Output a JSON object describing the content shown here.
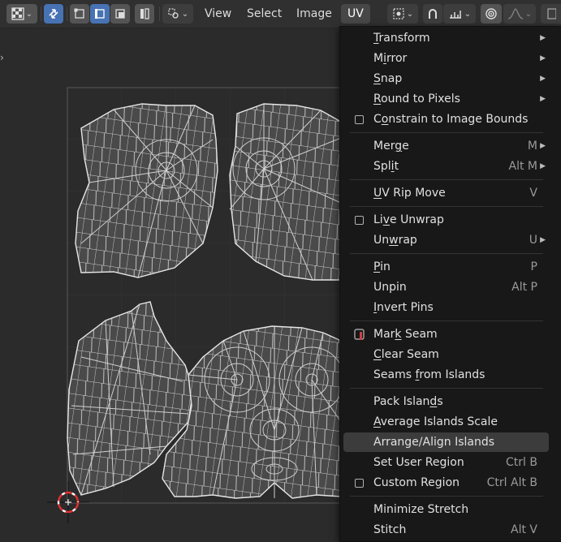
{
  "header": {
    "menus": [
      {
        "label": "View",
        "active": false
      },
      {
        "label": "Select",
        "active": false
      },
      {
        "label": "Image",
        "active": false
      },
      {
        "label": "UV",
        "active": true
      }
    ],
    "icons": [
      "editor-type-icon",
      "sync-selection-icon",
      "vertex-select-icon",
      "edge-select-icon",
      "face-select-icon",
      "island-select-icon",
      "sticky-selection-icon",
      "pivot-icon",
      "snap-magnet-icon",
      "snap-target-icon",
      "proportional-edit-icon",
      "falloff-icon"
    ]
  },
  "menu": {
    "items": [
      {
        "label": "Transform",
        "ul": "T",
        "shortcut": "",
        "submenu": true,
        "checkbox": false
      },
      {
        "label": "Mirror",
        "ul": "i",
        "shortcut": "",
        "submenu": true,
        "checkbox": false
      },
      {
        "label": "Snap",
        "ul": "S",
        "shortcut": "",
        "submenu": true,
        "checkbox": false
      },
      {
        "label": "Round to Pixels",
        "ul": "R",
        "shortcut": "",
        "submenu": true,
        "checkbox": false
      },
      {
        "label": "Constrain to Image Bounds",
        "ul": "o",
        "shortcut": "",
        "submenu": false,
        "checkbox": true
      },
      {
        "label": "Merge",
        "ul": "g",
        "shortcut": "M",
        "submenu": true,
        "checkbox": false
      },
      {
        "label": "Split",
        "ul": "i",
        "shortcut": "Alt M",
        "submenu": true,
        "checkbox": false
      },
      {
        "label": "UV Rip Move",
        "ul": "U",
        "shortcut": "V",
        "submenu": false,
        "checkbox": false
      },
      {
        "label": "Live Unwrap",
        "ul": "v",
        "shortcut": "",
        "submenu": false,
        "checkbox": true
      },
      {
        "label": "Unwrap",
        "ul": "w",
        "shortcut": "U",
        "submenu": true,
        "checkbox": false
      },
      {
        "label": "Pin",
        "ul": "P",
        "shortcut": "P",
        "submenu": false,
        "checkbox": false
      },
      {
        "label": "Unpin",
        "ul": "",
        "shortcut": "Alt P",
        "submenu": false,
        "checkbox": false
      },
      {
        "label": "Invert Pins",
        "ul": "I",
        "shortcut": "",
        "submenu": false,
        "checkbox": false
      },
      {
        "label": "Mark Seam",
        "ul": "k",
        "shortcut": "",
        "submenu": false,
        "checkbox": false,
        "icon": "mark-seam-icon"
      },
      {
        "label": "Clear Seam",
        "ul": "C",
        "shortcut": "",
        "submenu": false,
        "checkbox": false
      },
      {
        "label": "Seams from Islands",
        "ul": "f",
        "shortcut": "",
        "submenu": false,
        "checkbox": false
      },
      {
        "label": "Pack Islands",
        "ul": "d",
        "shortcut": "",
        "submenu": false,
        "checkbox": false
      },
      {
        "label": "Average Islands Scale",
        "ul": "A",
        "shortcut": "",
        "submenu": false,
        "checkbox": false
      },
      {
        "label": "Arrange/Align Islands",
        "ul": "",
        "shortcut": "",
        "submenu": false,
        "checkbox": false,
        "highlighted": true
      },
      {
        "label": "Set User Region",
        "ul": "",
        "shortcut": "Ctrl B",
        "submenu": false,
        "checkbox": false
      },
      {
        "label": "Custom Region",
        "ul": "",
        "shortcut": "Ctrl Alt B",
        "submenu": false,
        "checkbox": true
      },
      {
        "label": "Minimize Stretch",
        "ul": "",
        "shortcut": "",
        "submenu": false,
        "checkbox": false
      },
      {
        "label": "Stitch",
        "ul": "",
        "shortcut": "Alt V",
        "submenu": false,
        "checkbox": false
      }
    ]
  },
  "colors": {
    "header_bg": "#303030",
    "viewport_bg": "#2b2b2b",
    "menu_bg": "#181818",
    "highlight": "#3c3c3c",
    "accent_blue": "#4772b3",
    "mesh_face": "#4a4a4a",
    "mesh_edge": "#d8d8d8",
    "cursor_red": "#e03030"
  }
}
